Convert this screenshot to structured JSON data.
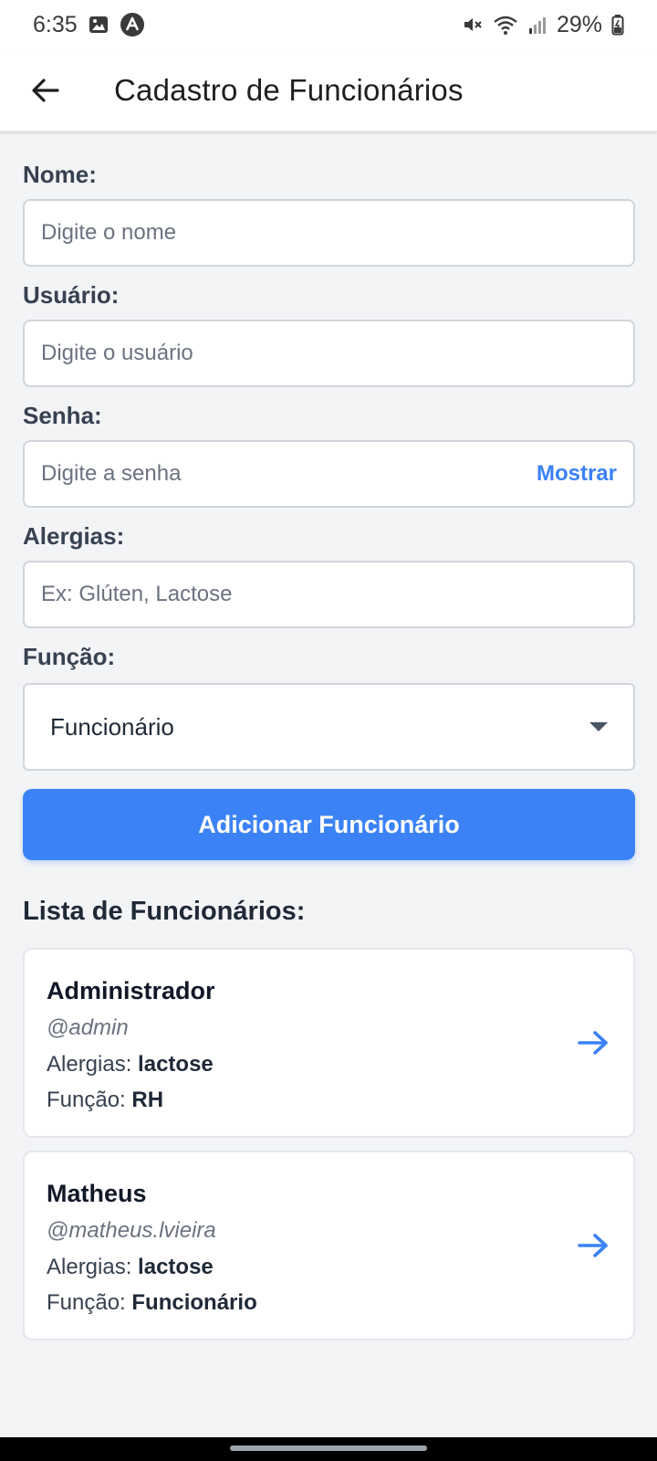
{
  "status_bar": {
    "time": "6:35",
    "battery": "29%",
    "icons": [
      "gallery-icon",
      "app-a-icon",
      "mute-icon",
      "wifi-icon",
      "signal-icon",
      "battery-icon"
    ]
  },
  "header": {
    "title": "Cadastro de Funcionários",
    "back_icon": "arrow-left-icon"
  },
  "form": {
    "name": {
      "label": "Nome:",
      "placeholder": "Digite o nome"
    },
    "username": {
      "label": "Usuário:",
      "placeholder": "Digite o usuário"
    },
    "password": {
      "label": "Senha:",
      "placeholder": "Digite a senha",
      "toggle_label": "Mostrar"
    },
    "allergies": {
      "label": "Alergias:",
      "placeholder": "Ex: Glúten, Lactose"
    },
    "role": {
      "label": "Função:",
      "selected": "Funcionário"
    },
    "submit_label": "Adicionar Funcionário"
  },
  "list": {
    "title": "Lista de Funcionários:",
    "allergies_prefix": "Alergias:",
    "role_prefix": "Função:",
    "items": [
      {
        "name": "Administrador",
        "username": "@admin",
        "allergies": "lactose",
        "role": "RH"
      },
      {
        "name": "Matheus",
        "username": "@matheus.lvieira",
        "allergies": "lactose",
        "role": "Funcionário"
      }
    ]
  },
  "colors": {
    "accent": "#3b82f6",
    "background": "#f3f4f6",
    "card": "#ffffff",
    "label": "#374151"
  }
}
